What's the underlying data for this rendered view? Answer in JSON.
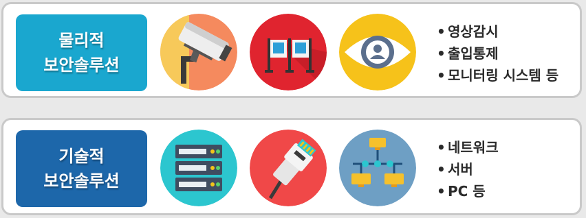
{
  "physical": {
    "title": "물리적\n보안솔루션",
    "icons": [
      "cctv-camera-icon",
      "gate-monitor-icon",
      "eye-user-icon"
    ],
    "items": [
      "영상감시",
      "출입통제",
      "모니터링 시스템 등"
    ],
    "color": "#1aa7cf"
  },
  "technical": {
    "title": "기술적\n보안솔루션",
    "icons": [
      "server-rack-icon",
      "network-cable-icon",
      "network-topology-icon"
    ],
    "items": [
      "네트워크",
      "서버",
      "PC 등"
    ],
    "color": "#1d67aa"
  }
}
